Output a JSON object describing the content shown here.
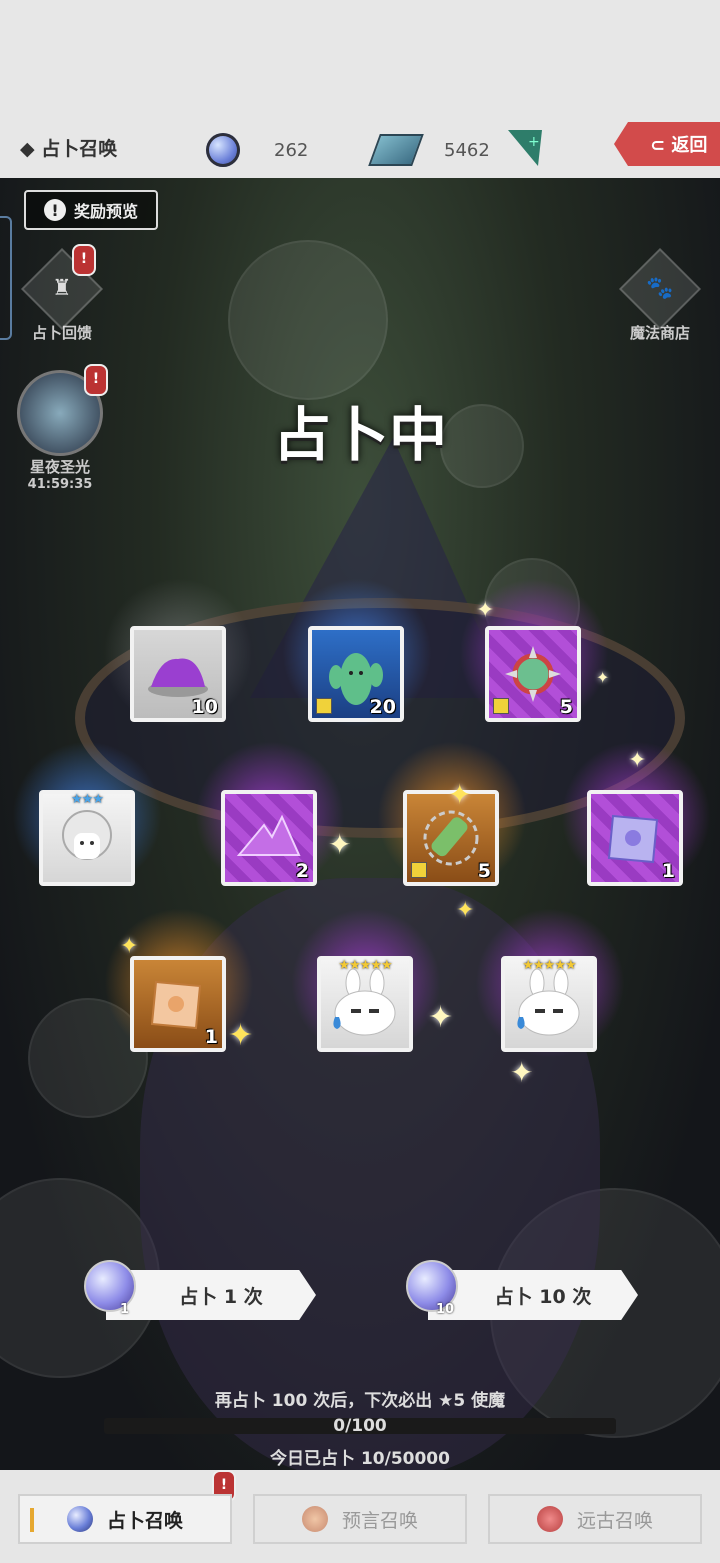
{
  "header": {
    "title": "◆ 占卜召唤",
    "orb_count": "262",
    "gem_count": "5462",
    "back_label": "⊂ 返回"
  },
  "scene": {
    "reward_preview_label": "奖励预览",
    "left_menu": [
      {
        "label": "占卜回馈",
        "icon": "castle-icon"
      },
      {
        "label": "星夜圣光",
        "timer": "41:59:35",
        "icon": "star-badge-icon"
      }
    ],
    "right_menu": [
      {
        "label": "魔法商店",
        "icon": "paw-icon"
      }
    ],
    "heading": "占卜中"
  },
  "rewards": [
    {
      "rarity": "gray",
      "quantity": "10",
      "icon": "purple-dust-icon",
      "fragment": false
    },
    {
      "rarity": "blue",
      "quantity": "20",
      "icon": "cactus-monster-icon",
      "fragment": true
    },
    {
      "rarity": "purple",
      "quantity": "5",
      "icon": "spiked-ball-icon",
      "fragment": true
    },
    {
      "rarity": "white",
      "quantity": "",
      "icon": "white-haired-character-icon",
      "stars": "★★★",
      "star_color": "blue"
    },
    {
      "rarity": "purple",
      "quantity": "2",
      "icon": "crystal-pile-icon",
      "fragment": false
    },
    {
      "rarity": "orange",
      "quantity": "5",
      "icon": "spiked-scroll-icon",
      "fragment": true
    },
    {
      "rarity": "purple",
      "quantity": "1",
      "icon": "map-scroll-icon",
      "fragment": false
    },
    {
      "rarity": "orange",
      "quantity": "1",
      "icon": "map-scroll-icon",
      "fragment": false
    },
    {
      "rarity": "white",
      "quantity": "",
      "icon": "bunny-character-icon",
      "stars": "★★★★★",
      "star_color": "gold"
    },
    {
      "rarity": "white",
      "quantity": "",
      "icon": "bunny-character-icon",
      "stars": "★★★★★",
      "star_color": "gold"
    }
  ],
  "actions": {
    "single": {
      "label": "占卜 1 次",
      "cost": "1"
    },
    "ten": {
      "label": "占卜 10 次",
      "cost": "10"
    }
  },
  "progress": {
    "hint": "再占卜 100 次后，下次必出 ★5 使魔",
    "value_text": "0/100",
    "fraction": 0,
    "today": "今日已占卜 10/50000"
  },
  "tabs": [
    {
      "label": "占卜召唤",
      "active": true
    },
    {
      "label": "预言召唤",
      "active": false
    },
    {
      "label": "远古召唤",
      "active": false
    }
  ],
  "colors": {
    "accent_red": "#d24b4b",
    "purple_rarity": "#b24fd8",
    "blue_rarity": "#2e6fc7",
    "orange_rarity": "#c98537",
    "gray_rarity": "#c9c9c9"
  }
}
